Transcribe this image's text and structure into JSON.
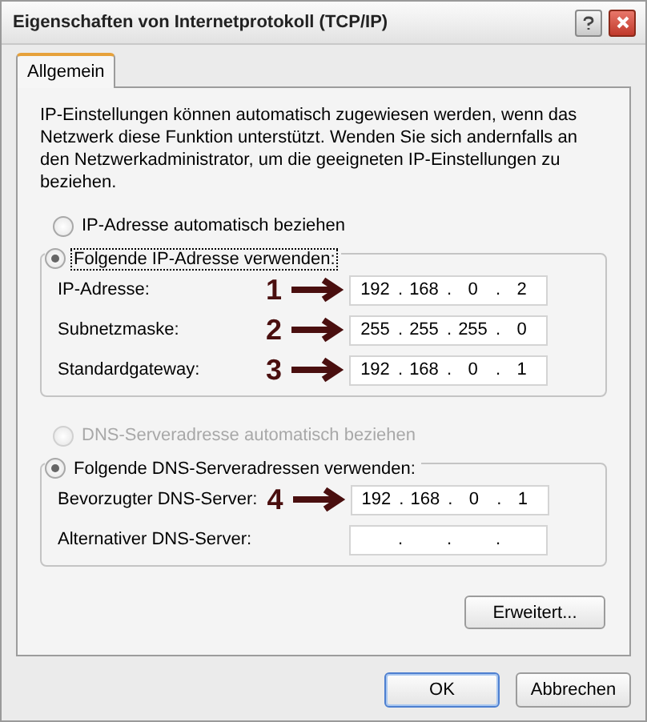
{
  "window": {
    "title": "Eigenschaften von Internetprotokoll (TCP/IP)"
  },
  "tabs": [
    {
      "label": "Allgemein",
      "selected": true
    }
  ],
  "intro": "IP-Einstellungen können automatisch zugewiesen werden, wenn das Netzwerk diese Funktion unterstützt. Wenden Sie sich andernfalls an den Netzwerkadministrator, um die geeigneten IP-Einstellungen zu beziehen.",
  "separator": ".",
  "sections": [
    {
      "auto_option": {
        "label": "IP-Adresse automatisch beziehen",
        "selected": false,
        "disabled": false
      },
      "manual_option": {
        "label": "Folgende IP-Adresse verwenden:",
        "selected": true,
        "focused": true
      },
      "fields": [
        {
          "label": "IP-Adresse:",
          "marker": "1",
          "octets": [
            "192",
            "168",
            "0",
            "2"
          ]
        },
        {
          "label": "Subnetzmaske:",
          "marker": "2",
          "octets": [
            "255",
            "255",
            "255",
            "0"
          ]
        },
        {
          "label": "Standardgateway:",
          "marker": "3",
          "octets": [
            "192",
            "168",
            "0",
            "1"
          ]
        }
      ]
    },
    {
      "auto_option": {
        "label": "DNS-Serveradresse automatisch beziehen",
        "selected": false,
        "disabled": true
      },
      "manual_option": {
        "label": "Folgende DNS-Serveradressen verwenden:",
        "selected": true,
        "focused": false
      },
      "fields": [
        {
          "label": "Bevorzugter DNS-Server:",
          "marker": "4",
          "octets": [
            "192",
            "168",
            "0",
            "1"
          ]
        },
        {
          "label": "Alternativer DNS-Server:"
        }
      ]
    }
  ],
  "advanced_button": "Erweitert...",
  "buttons": [
    {
      "label": "OK",
      "default": true
    },
    {
      "label": "Abbrechen",
      "default": false
    }
  ]
}
